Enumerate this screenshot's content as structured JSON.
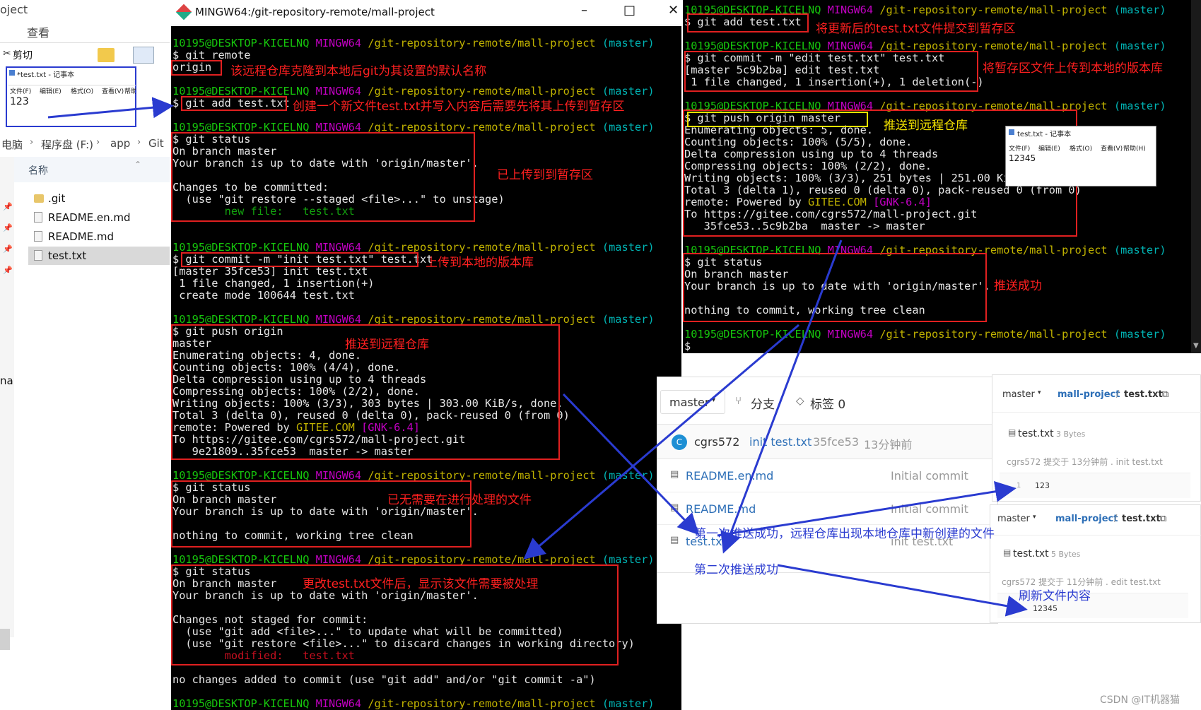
{
  "explorer": {
    "breadcrumb_start": "oject",
    "ribbon_tab": "查看",
    "cut_label": "剪切",
    "path": [
      "电脑",
      "程序盘 (F:)",
      "app",
      "Git"
    ],
    "column_name": "名称",
    "files": [
      ".git",
      "README.en.md",
      "README.md",
      "test.txt"
    ],
    "side_fragment": "na"
  },
  "notepad_left": {
    "title": "*test.txt - 记事本",
    "menu": [
      "文件(F)",
      "编辑(E)",
      "格式(O)",
      "查看(V)",
      "帮助(H)"
    ],
    "content": "123"
  },
  "terminal_left": {
    "window_title": "MINGW64:/git-repository-remote/mall-project",
    "prompt_user": "10195@DESKTOP-KICELNQ",
    "prompt_env": "MINGW64",
    "prompt_path": "/git-repository-remote/mall-project",
    "prompt_branch": "(master)",
    "cmd_remote": "$ git remote",
    "out_origin": "origin",
    "cmd_add": "$ git add test.txt",
    "cmd_status": "$ git status",
    "on_branch": "On branch master",
    "up_to_date": "Your branch is up to date with 'origin/master'.",
    "changes_committed": "Changes to be committed:",
    "restore_staged": "  (use \"git restore --staged <file>...\" to unstage)",
    "new_file": "        new file:   test.txt",
    "cmd_commit": "$ git commit -m \"init test.txt\" test.txt",
    "commit_out1": "[master 35fce53] init test.txt",
    "commit_out2": " 1 file changed, 1 insertion(+)",
    "commit_out3": " create mode 100644 test.txt",
    "cmd_push": "$ git push origin",
    "push_master": "master",
    "push_lines": [
      "Enumerating objects: 4, done.",
      "Counting objects: 100% (4/4), done.",
      "Delta compression using up to 4 threads",
      "Compressing objects: 100% (2/2), done.",
      "Writing objects: 100% (3/3), 303 bytes | 303.00 KiB/s, done.",
      "Total 3 (delta 0), reused 0 (delta 0), pack-reused 0 (from 0)"
    ],
    "remote_powered": "remote: Powered by ",
    "gitee_com": "GITEE.COM",
    "gnk": "[GNK-6.4]",
    "push_to": "To https://gitee.com/cgrs572/mall-project.git",
    "push_ref": "   9e21809..35fce53  master -> master",
    "nothing_commit": "nothing to commit, working tree clean",
    "changes_not_staged": "Changes not staged for commit:",
    "use_add": "  (use \"git add <file>...\" to update what will be committed)",
    "use_restore": "  (use \"git restore <file>...\" to discard changes in working directory)",
    "modified": "        modified:   test.txt",
    "no_changes": "no changes added to commit (use \"git add\" and/or \"git commit -a\")",
    "notes": {
      "origin": "该远程仓库克隆到本地后git为其设置的默认名称",
      "add": "创建一个新文件test.txt并写入内容后需要先将其上传到暂存区",
      "staged": "已上传到到暂存区",
      "commit": "上传到本地的版本库",
      "push": "推送到远程仓库",
      "nothing": "已无需要在进行处理的文件",
      "modified": "更改test.txt文件后，显示该文件需要被处理"
    }
  },
  "terminal_right": {
    "cmd_add": "$ git add test.txt",
    "cmd_commit": "$ git commit -m \"edit test.txt\" test.txt",
    "commit_out1": "[master 5c9b2ba] edit test.txt",
    "commit_out2": " 1 file changed, 1 insertion(+), 1 deletion(-)",
    "cmd_push": "$ git push origin master",
    "push_lines": [
      "Enumerating objects: 5, done.",
      "Counting objects: 100% (5/5), done.",
      "Delta compression using up to 4 threads",
      "Compressing objects: 100% (2/2), done.",
      "Writing objects: 100% (3/3), 251 bytes | 251.00 KiB/s, done.",
      "Total 3 (delta 1), reused 0 (delta 0), pack-reused 0 (from 0)"
    ],
    "push_to": "To https://gitee.com/cgrs572/mall-project.git",
    "push_ref": "   35fce53..5c9b2ba  master -> master",
    "cmd_status": "$ git status",
    "on_branch": "On branch master",
    "up_to_date": "Your branch is up to date with 'origin/master'.",
    "nothing_commit": "nothing to commit, working tree clean",
    "prompt_cursor": "$",
    "notes": {
      "add": "将更新后的test.txt文件提交到暂存区",
      "commit": "将暂存区文件上传到本地的版本库",
      "push": "推送到远程仓库",
      "success": "推送成功"
    }
  },
  "notepad_right": {
    "title": "test.txt - 记事本",
    "menu": [
      "文件(F)",
      "编辑(E)",
      "格式(O)",
      "查看(V)",
      "帮助(H)"
    ],
    "content": "12345"
  },
  "gitee": {
    "branch": "master",
    "branches_label": "分支",
    "tags_label": "标签 0",
    "commit_user": "cgrs572",
    "commit_msg": "init test.txt",
    "commit_hash": "35fce53",
    "commit_time": "13分钟前",
    "avatar_letter": "C",
    "files": [
      {
        "name": "README.en.md",
        "msg": "Initial commit"
      },
      {
        "name": "README.md",
        "msg": "Initial commit"
      },
      {
        "name": "test.txt",
        "msg": "init test.txt"
      }
    ],
    "note_first": "第一次推送成功，远程仓库出现本地仓库中新创建的文件",
    "note_second": "第二次推送成功"
  },
  "file_card_1": {
    "branch": "master",
    "repo": "mall-project",
    "sep": "/",
    "file": "test.txt",
    "file_size": "3 Bytes",
    "commit_info": "cgrs572 提交于 13分钟前 . init test.txt",
    "line_no": "1",
    "line_content": "123"
  },
  "file_card_2": {
    "branch": "master",
    "repo": "mall-project",
    "sep": "/",
    "file": "test.txt",
    "file_size": "5 Bytes",
    "commit_info": "cgrs572 提交于 11分钟前 . edit test.txt",
    "refresh_note": "刷新文件内容",
    "line_content": "12345"
  },
  "watermark": "CSDN @IT机器猫",
  "window_controls": {
    "minimize": "–",
    "maximize": "□",
    "close": "✕"
  }
}
